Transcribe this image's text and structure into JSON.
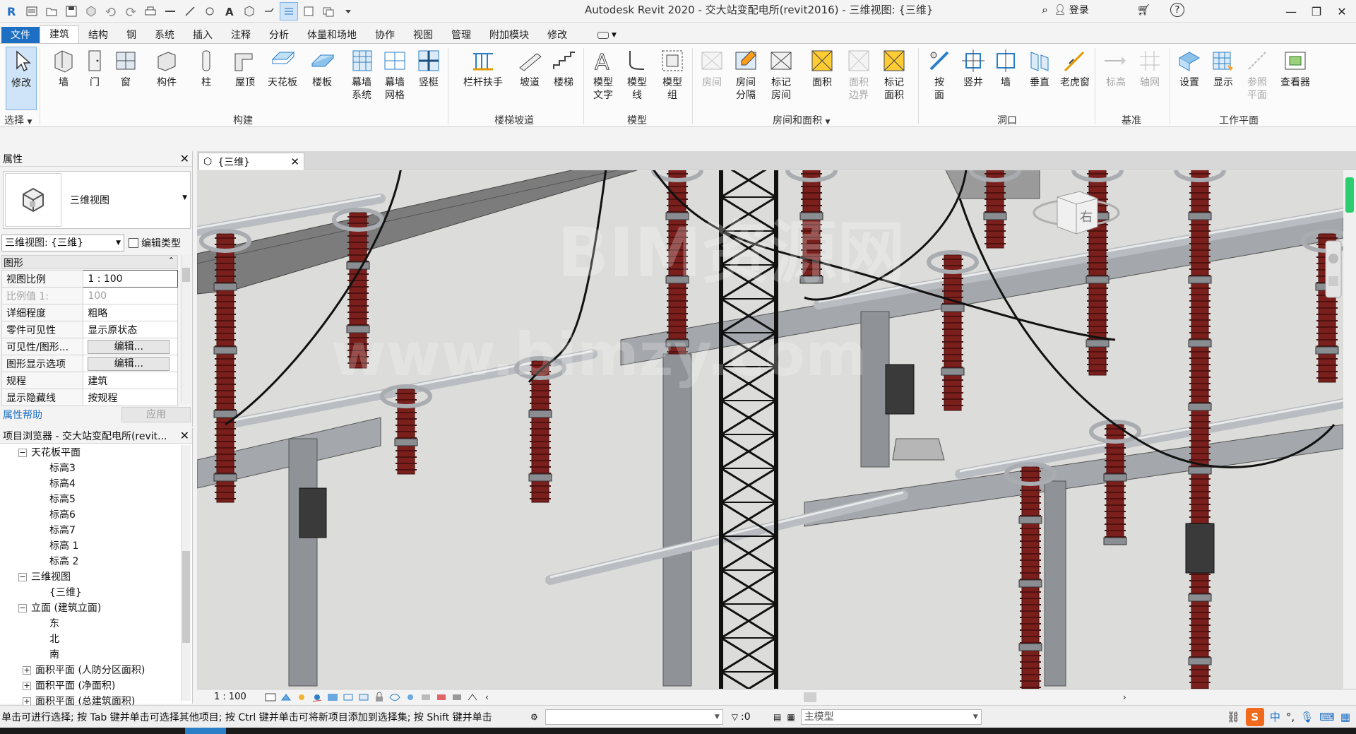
{
  "app": {
    "window_title": "Autodesk Revit 2020 - 交大站变配电所(revit2016) - 三维视图: {三维}",
    "login_label": "登录",
    "login_label_right": "登录"
  },
  "ribbon_tabs": [
    "文件",
    "建筑",
    "结构",
    "钢",
    "系统",
    "插入",
    "注释",
    "分析",
    "体量和场地",
    "协作",
    "视图",
    "管理",
    "附加模块",
    "修改"
  ],
  "ribbon_active_tab": "建筑",
  "ribbon": {
    "select_label": "选择",
    "groups": {
      "build": "构建",
      "stairs": "楼梯坡道",
      "model": "模型",
      "room": "房间和面积",
      "opening": "洞口",
      "datum": "基准",
      "workplane": "工作平面"
    },
    "buttons": {
      "modify": "修改",
      "wall": "墙",
      "door": "门",
      "window": "窗",
      "component": "构件",
      "column": "柱",
      "roof": "屋顶",
      "ceiling": "天花板",
      "floor": "楼板",
      "curtain_system": "幕墙\n系统",
      "curtain_grid": "幕墙\n网格",
      "mullion": "竖梃",
      "railing": "栏杆扶手",
      "ramp": "坡道",
      "stair": "楼梯",
      "model_text": "模型\n文字",
      "model_line": "模型\n线",
      "model_group": "模型\n组",
      "room": "房间",
      "room_separator": "房间\n分隔",
      "tag_room": "标记\n房间",
      "area": "面积",
      "area_boundary": "面积\n边界",
      "tag_area": "标记\n面积",
      "by_face": "按\n面",
      "shaft": "竖井",
      "wall_opening": "墙",
      "vertical": "垂直",
      "dormer": "老虎窗",
      "level": "标高",
      "grid": "轴网",
      "set": "设置",
      "show": "显示",
      "ref_plane": "参照\n平面",
      "viewer": "查看器"
    }
  },
  "properties": {
    "title": "属性",
    "type_name": "三维视图",
    "instance_selector": "三维视图: {三维}",
    "edit_type_label": "编辑类型",
    "category": "图形",
    "rows": [
      {
        "key": "视图比例",
        "value": "1 : 100"
      },
      {
        "key": "比例值 1:",
        "value": "100"
      },
      {
        "key": "详细程度",
        "value": "粗略"
      },
      {
        "key": "零件可见性",
        "value": "显示原状态"
      },
      {
        "key": "可见性/图形...",
        "value": "编辑..."
      },
      {
        "key": "图形显示选项",
        "value": "编辑..."
      },
      {
        "key": "规程",
        "value": "建筑"
      },
      {
        "key": "显示隐藏线",
        "value": "按规程"
      }
    ],
    "help_link": "属性帮助",
    "apply_label": "应用"
  },
  "project_browser": {
    "title": "项目浏览器 - 交大站变配电所(revit...",
    "nodes": [
      {
        "label": "天花板平面",
        "depth": 1,
        "toggle": "−"
      },
      {
        "label": "标高3",
        "depth": 2
      },
      {
        "label": "标高4",
        "depth": 2
      },
      {
        "label": "标高5",
        "depth": 2
      },
      {
        "label": "标高6",
        "depth": 2
      },
      {
        "label": "标高7",
        "depth": 2
      },
      {
        "label": "标高 1",
        "depth": 2
      },
      {
        "label": "标高 2",
        "depth": 2
      },
      {
        "label": "三维视图",
        "depth": 1,
        "toggle": "−"
      },
      {
        "label": "{三维}",
        "depth": 2
      },
      {
        "label": "立面 (建筑立面)",
        "depth": 1,
        "toggle": "−"
      },
      {
        "label": "东",
        "depth": 2
      },
      {
        "label": "北",
        "depth": 2
      },
      {
        "label": "南",
        "depth": 2
      },
      {
        "label": "面积平面 (人防分区面积)",
        "depth": 0,
        "toggle": "+"
      },
      {
        "label": "面积平面 (净面积)",
        "depth": 0,
        "toggle": "+"
      },
      {
        "label": "面积平面 (总建筑面积)",
        "depth": 0,
        "toggle": "+"
      }
    ]
  },
  "view": {
    "tab_label": "{三维}",
    "scale_label": "1 : 100",
    "watermark_text": "BIM资源网",
    "watermark_url": "www.bimzy.com",
    "viewcube_face": "右"
  },
  "status_bar": {
    "message": "单击可进行选择; 按 Tab 键并单击可选择其他项目; 按 Ctrl 键并单击可将新项目添加到选择集; 按 Shift 键并单击",
    "selection_count": ":0",
    "model_combo": "主模型",
    "ime_label": "中"
  },
  "colors": {
    "file_tab": "#1d6fc4",
    "insulator": "#7a1f1c",
    "steel": "#8f9398",
    "viewport_bg": "#dcdcda"
  }
}
